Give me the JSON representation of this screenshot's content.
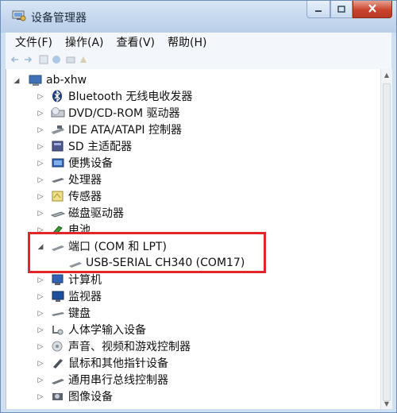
{
  "window": {
    "title": "设备管理器"
  },
  "menu": {
    "items": [
      "文件(F)",
      "操作(A)",
      "查看(V)",
      "帮助(H)"
    ]
  },
  "toolbar": {
    "buttons": [
      "back-icon",
      "forward-icon",
      "properties-icon",
      "help-icon",
      "scan-icon",
      "device-icon"
    ]
  },
  "tree": {
    "root": {
      "label": "ab-xhw",
      "icon": "computer-icon",
      "expanded": true
    },
    "categories": [
      {
        "label": "Bluetooth 无线电收发器",
        "icon": "bluetooth-icon",
        "expanded": false
      },
      {
        "label": "DVD/CD-ROM 驱动器",
        "icon": "dvd-drive-icon",
        "expanded": false
      },
      {
        "label": "IDE ATA/ATAPI 控制器",
        "icon": "ide-controller-icon",
        "expanded": false
      },
      {
        "label": "SD 主适配器",
        "icon": "sd-adapter-icon",
        "expanded": false
      },
      {
        "label": "便携设备",
        "icon": "portable-device-icon",
        "expanded": false
      },
      {
        "label": "处理器",
        "icon": "processor-icon",
        "expanded": false
      },
      {
        "label": "传感器",
        "icon": "sensor-icon",
        "expanded": false
      },
      {
        "label": "磁盘驱动器",
        "icon": "disk-drive-icon",
        "expanded": false
      },
      {
        "label": "电池",
        "icon": "battery-icon",
        "expanded": false
      },
      {
        "label": "端口 (COM 和 LPT)",
        "icon": "port-icon",
        "expanded": true,
        "children": [
          {
            "label": "USB-SERIAL CH340 (COM17)",
            "icon": "port-icon"
          }
        ]
      },
      {
        "label": "计算机",
        "icon": "computer-icon",
        "expanded": false
      },
      {
        "label": "监视器",
        "icon": "monitor-icon",
        "expanded": false
      },
      {
        "label": "键盘",
        "icon": "keyboard-icon",
        "expanded": false
      },
      {
        "label": "人体学输入设备",
        "icon": "hid-icon",
        "expanded": false
      },
      {
        "label": "声音、视频和游戏控制器",
        "icon": "sound-icon",
        "expanded": false
      },
      {
        "label": "鼠标和其他指针设备",
        "icon": "mouse-icon",
        "expanded": false
      },
      {
        "label": "通用串行总线控制器",
        "icon": "usb-icon",
        "expanded": false
      },
      {
        "label": "图像设备",
        "icon": "imaging-icon",
        "expanded": false
      }
    ]
  },
  "colors": {
    "highlight_border": "#e0262b",
    "title_bar": "#c4d7ee",
    "close_button": "#c9432d"
  }
}
